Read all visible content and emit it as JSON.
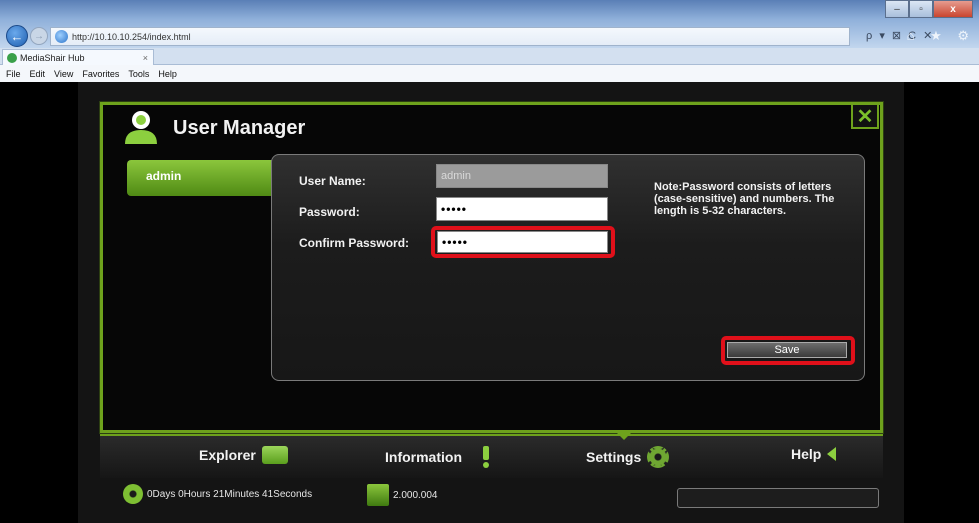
{
  "browser": {
    "url": "http://10.10.10.254/index.html",
    "tab_title": "MediaShair Hub",
    "tab_close": "×",
    "back_icon": "back-arrow-icon",
    "forward_icon": "forward-arrow-icon",
    "addr_tools": "ρ ▾ ⊠ C ✕",
    "window_controls": [
      "–",
      "▫",
      "x"
    ],
    "right_icons": "⌂ ★ ⚙",
    "menu": [
      "File",
      "Edit",
      "View",
      "Favorites",
      "Tools",
      "Help"
    ]
  },
  "dialog": {
    "title": "User Manager",
    "close_glyph": "✕",
    "user_tab": "admin",
    "labels": {
      "username": "User Name:",
      "password": "Password:",
      "confirm": "Confirm Password:"
    },
    "values": {
      "username": "admin",
      "password": "•••••",
      "confirm": "•••••"
    },
    "note": "Note:Password consists of letters (case-sensitive) and numbers. The length is 5-32 characters.",
    "save_label": "Save",
    "highlight_color": "#e0101a",
    "accent": "#6ea21c"
  },
  "nav": {
    "items": [
      {
        "label": "Explorer",
        "icon": "folder-icon"
      },
      {
        "label": "Information",
        "icon": "exclamation-icon"
      },
      {
        "label": "Settings",
        "icon": "gear-icon"
      },
      {
        "label": "Help",
        "icon": "arrow-left-icon"
      }
    ],
    "active": "Settings"
  },
  "status": {
    "uptime": "0Days 0Hours 21Minutes 41Seconds",
    "version": "2.000.004"
  }
}
